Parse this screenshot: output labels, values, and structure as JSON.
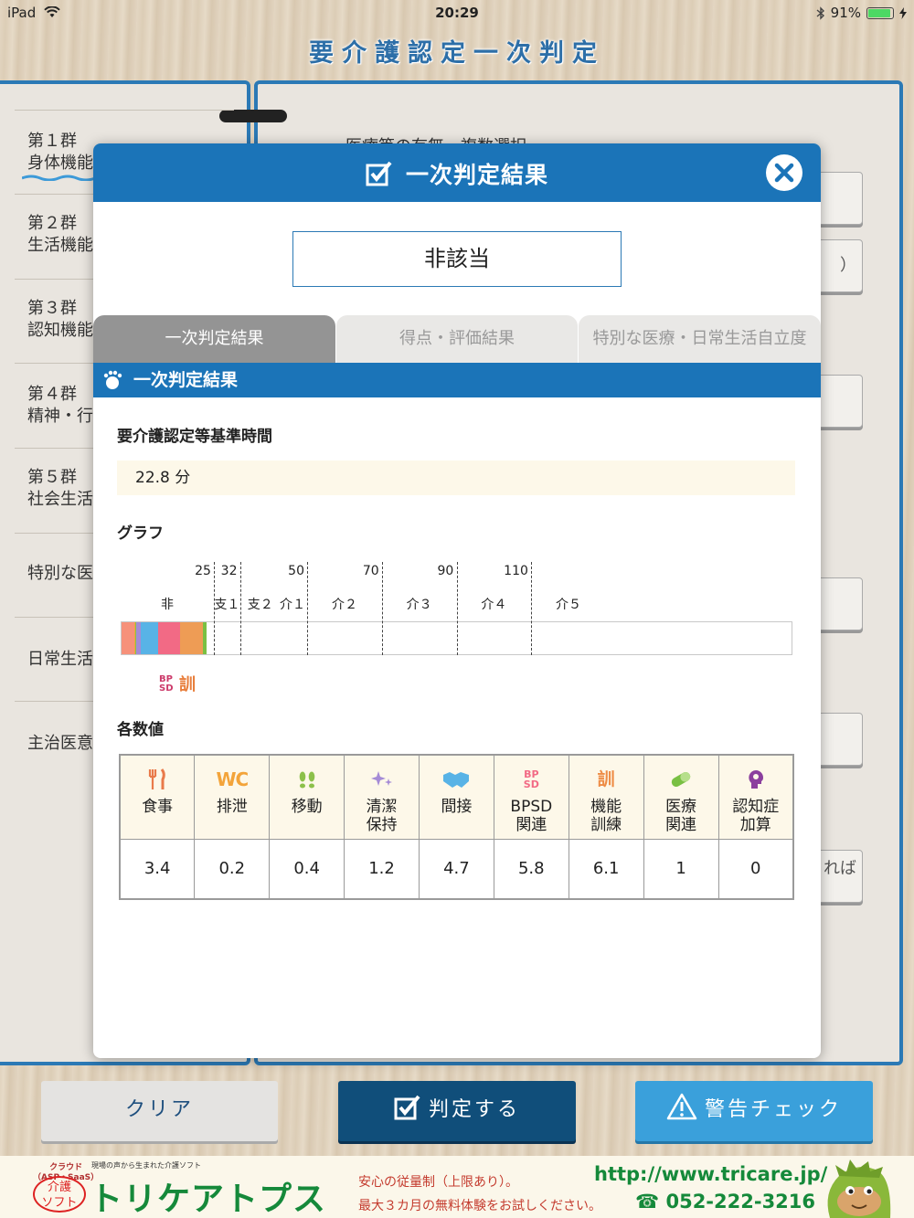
{
  "status_bar": {
    "device": "iPad",
    "time": "20:29",
    "battery": "91%"
  },
  "app_title": "要介護認定一次判定",
  "background_nav": {
    "groups": [
      {
        "num": "第１群",
        "name": "身体機能"
      },
      {
        "num": "第２群",
        "name": "生活機能"
      },
      {
        "num": "第３群",
        "name": "認知機能"
      },
      {
        "num": "第４群",
        "name": "精神・行"
      },
      {
        "num": "第５群",
        "name": "社会生活"
      },
      {
        "num": "",
        "name": "特別な医"
      },
      {
        "num": "",
        "name": "日常生活"
      },
      {
        "num": "",
        "name": "主治医意"
      }
    ],
    "right_snippets": {
      "paren": "）",
      "ba": "れば"
    },
    "header_text": "医療等の有無　複数選択"
  },
  "modal": {
    "title": "一次判定結果",
    "result": "非該当",
    "tabs": [
      "一次判定結果",
      "得点・評価結果",
      "特別な医療・日常生活自立度"
    ],
    "section_title": "一次判定結果",
    "time_label": "要介護認定等基準時間",
    "time_value": "22.8 分",
    "graph_label": "グラフ",
    "values_label": "各数値"
  },
  "chart_data": {
    "type": "bar",
    "orientation": "horizontal-stacked",
    "total": 22.8,
    "xlim": [
      0,
      180
    ],
    "thresholds": [
      25,
      32,
      50,
      70,
      90,
      110
    ],
    "threshold_labels": [
      "25",
      "32",
      "50",
      "70",
      "90",
      "110"
    ],
    "levels": [
      "非",
      "支１",
      "支２",
      "介１",
      "介２",
      "介３",
      "介４",
      "介５"
    ],
    "segments": [
      {
        "name": "食事",
        "value": 3.4,
        "color": "#f6917a"
      },
      {
        "name": "排泄",
        "value": 0.2,
        "color": "#f3a43a"
      },
      {
        "name": "移動",
        "value": 0.4,
        "color": "#8cc04a"
      },
      {
        "name": "清潔保持",
        "value": 1.2,
        "color": "#a58bd6"
      },
      {
        "name": "間接",
        "value": 4.7,
        "color": "#58b3e6"
      },
      {
        "name": "BPSD関連",
        "value": 5.8,
        "color": "#f26a85"
      },
      {
        "name": "機能訓練",
        "value": 6.1,
        "color": "#ee9c55"
      },
      {
        "name": "医療関連",
        "value": 1,
        "color": "#79c043"
      },
      {
        "name": "認知症加算",
        "value": 0,
        "color": "#8b3f9e"
      }
    ],
    "legend": {
      "bpsd_top": "BP",
      "bpsd_bottom": "SD",
      "kun": "訓"
    }
  },
  "values_table": {
    "columns": [
      {
        "icon": "fork-knife-icon",
        "label1": "食事",
        "label2": "",
        "value": "3.4",
        "color": "#e97a4a"
      },
      {
        "icon": "wc-icon",
        "label1": "排泄",
        "label2": "",
        "value": "0.2",
        "color": "#f3a43a"
      },
      {
        "icon": "footprints-icon",
        "label1": "移動",
        "label2": "",
        "value": "0.4",
        "color": "#8cc04a"
      },
      {
        "icon": "sparkle-icon",
        "label1": "清潔",
        "label2": "保持",
        "value": "1.2",
        "color": "#a58bd6"
      },
      {
        "icon": "handshake-icon",
        "label1": "間接",
        "label2": "",
        "value": "4.7",
        "color": "#58b3e6"
      },
      {
        "icon": "bpsd-icon",
        "label1": "BPSD",
        "label2": "関連",
        "value": "5.8",
        "color": "#f26a85"
      },
      {
        "icon": "kun-icon",
        "label1": "機能",
        "label2": "訓練",
        "value": "6.1",
        "color": "#ee8c45"
      },
      {
        "icon": "pill-icon",
        "label1": "医療",
        "label2": "関連",
        "value": "1",
        "color": "#79c043"
      },
      {
        "icon": "brain-head-icon",
        "label1": "認知症",
        "label2": "加算",
        "value": "0",
        "color": "#8b3f9e"
      }
    ],
    "icon_text": {
      "wc": "WC",
      "bpsd_top": "BP",
      "bpsd_bottom": "SD",
      "kun": "訓"
    }
  },
  "buttons": {
    "clear": "クリア",
    "judge": "判定する",
    "warn": "警告チェック"
  },
  "ad": {
    "tagline": "現場の声から生まれた介護ソフト",
    "logo_top": "クラウド\n（ASP・SaaS）",
    "logo_circle": "介護\nソフト",
    "brand": "トリケアトプス",
    "line1": "安心の従量制（上限あり）。",
    "line2": "最大３カ月の無料体験をお試しください。",
    "url": "http://www.tricare.jp/",
    "phone": "☎ 052-222-3216"
  }
}
